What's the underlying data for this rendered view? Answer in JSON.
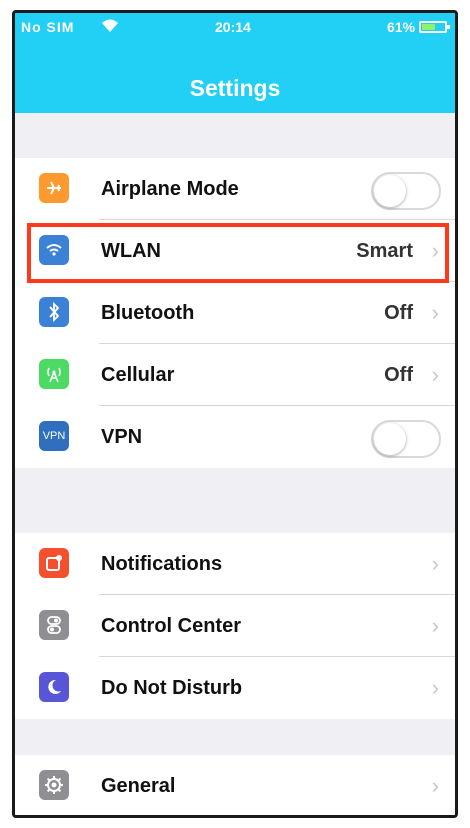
{
  "status_bar": {
    "carrier": "No SIM",
    "time": "20:14",
    "battery": "61%",
    "battery_level": 0.61
  },
  "nav": {
    "title": "Settings"
  },
  "colors": {
    "nav_bg": "#22d0f5",
    "highlight": "#ff3a1a"
  },
  "group1": [
    {
      "label": "Airplane Mode",
      "icon": "airplane-icon",
      "icon_color": "#fd9a2f",
      "type": "toggle",
      "on": false
    },
    {
      "label": "WLAN",
      "icon": "wifi-icon",
      "icon_color": "#3b82d6",
      "type": "detail",
      "value": "Smart"
    },
    {
      "label": "Bluetooth",
      "icon": "bluetooth-icon",
      "icon_color": "#3b82d6",
      "type": "detail",
      "value": "Off"
    },
    {
      "label": "Cellular",
      "icon": "cellular-icon",
      "icon_color": "#4cd964",
      "type": "detail",
      "value": "Off"
    },
    {
      "label": "VPN",
      "icon": "vpn-icon",
      "icon_color": "#2f6fbe",
      "icon_text": "VPN",
      "type": "toggle",
      "on": false
    }
  ],
  "group2": [
    {
      "label": "Notifications",
      "icon": "notifications-icon",
      "icon_color": "#f4502f",
      "type": "detail"
    },
    {
      "label": "Control Center",
      "icon": "control-center-icon",
      "icon_color": "#8e8e93",
      "type": "detail"
    },
    {
      "label": "Do Not Disturb",
      "icon": "moon-icon",
      "icon_color": "#5856d6",
      "type": "detail"
    }
  ],
  "group3": [
    {
      "label": "General",
      "icon": "gear-icon",
      "icon_color": "#8e8e93",
      "type": "detail"
    }
  ],
  "highlighted_item": "WLAN"
}
